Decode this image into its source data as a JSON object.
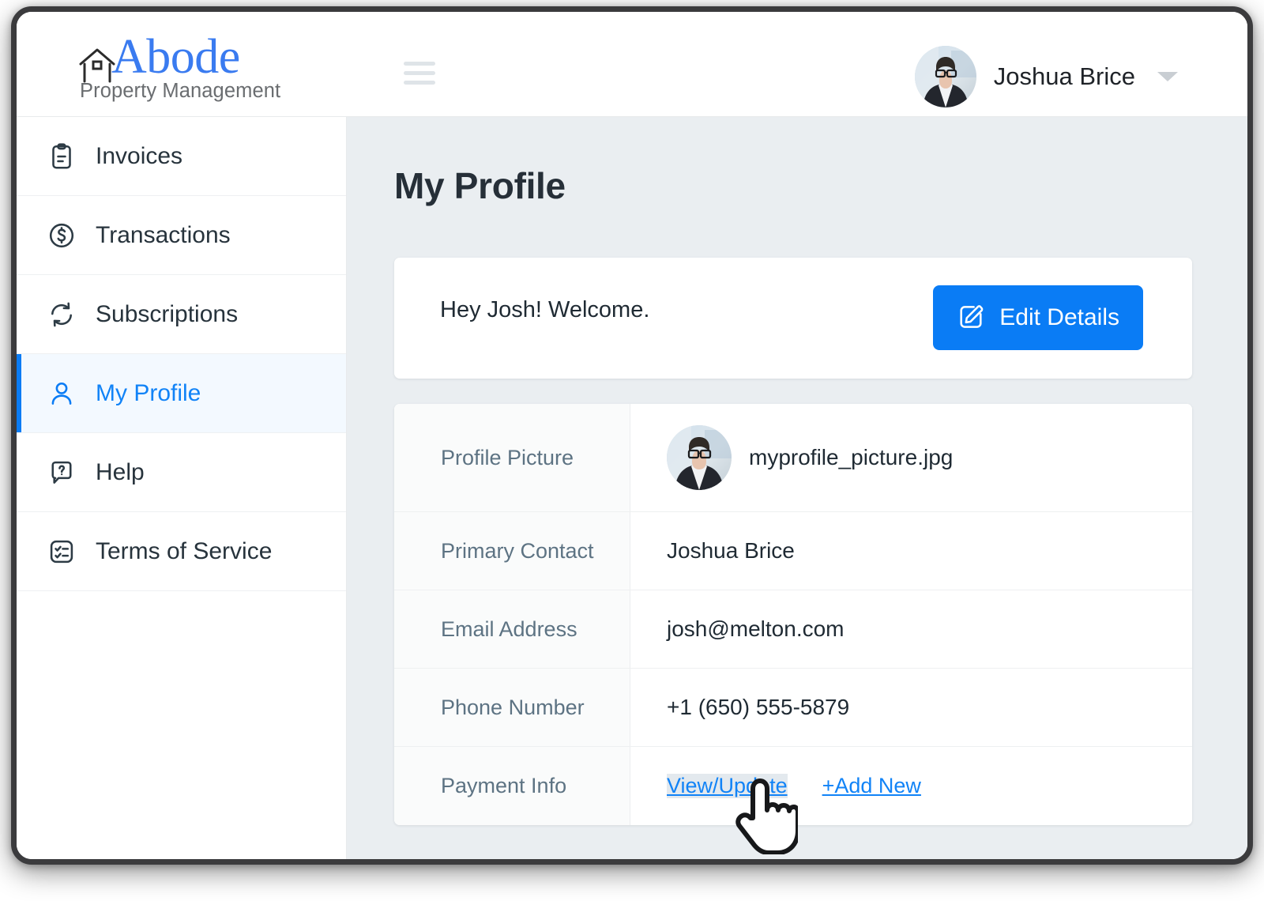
{
  "brand": {
    "name": "Abode",
    "tagline": "Property Management",
    "logo_icon": "house-icon",
    "accent_color": "#3a7bf0"
  },
  "header": {
    "menu_icon": "hamburger-menu-icon",
    "user_name": "Joshua Brice",
    "avatar_icon": "user-avatar-photo",
    "caret_icon": "chevron-down-icon"
  },
  "sidebar": {
    "items": [
      {
        "label": "Invoices",
        "icon": "clipboard-icon",
        "active": false
      },
      {
        "label": "Transactions",
        "icon": "dollar-circle-icon",
        "active": false
      },
      {
        "label": "Subscriptions",
        "icon": "refresh-sync-icon",
        "active": false
      },
      {
        "label": "My Profile",
        "icon": "person-icon",
        "active": true
      },
      {
        "label": "Help",
        "icon": "question-chat-icon",
        "active": false
      },
      {
        "label": "Terms of Service",
        "icon": "checklist-icon",
        "active": false
      }
    ]
  },
  "main": {
    "page_title": "My Profile",
    "welcome": {
      "message": "Hey Josh! Welcome.",
      "edit_button_label": "Edit Details",
      "edit_button_icon": "pencil-edit-icon",
      "edit_button_color": "#0a7cf5"
    },
    "details": {
      "rows": [
        {
          "label": "Profile Picture",
          "value": "myprofile_picture.jpg",
          "type": "image"
        },
        {
          "label": "Primary Contact",
          "value": "Joshua Brice",
          "type": "text"
        },
        {
          "label": "Email Address",
          "value": "josh@melton.com",
          "type": "text"
        },
        {
          "label": "Phone Number",
          "value": "+1 (650) 555-5879",
          "type": "text"
        },
        {
          "label": "Payment Info",
          "type": "links",
          "links": [
            {
              "label": "View/Update",
              "selected": true
            },
            {
              "label": "+Add New",
              "selected": false
            }
          ]
        }
      ]
    }
  },
  "cursor": {
    "icon": "pointing-hand-cursor"
  },
  "colors": {
    "accent": "#0a7cf5",
    "link": "#1183f7",
    "content_bg": "#eaeef1",
    "label_text": "#5d7383"
  }
}
